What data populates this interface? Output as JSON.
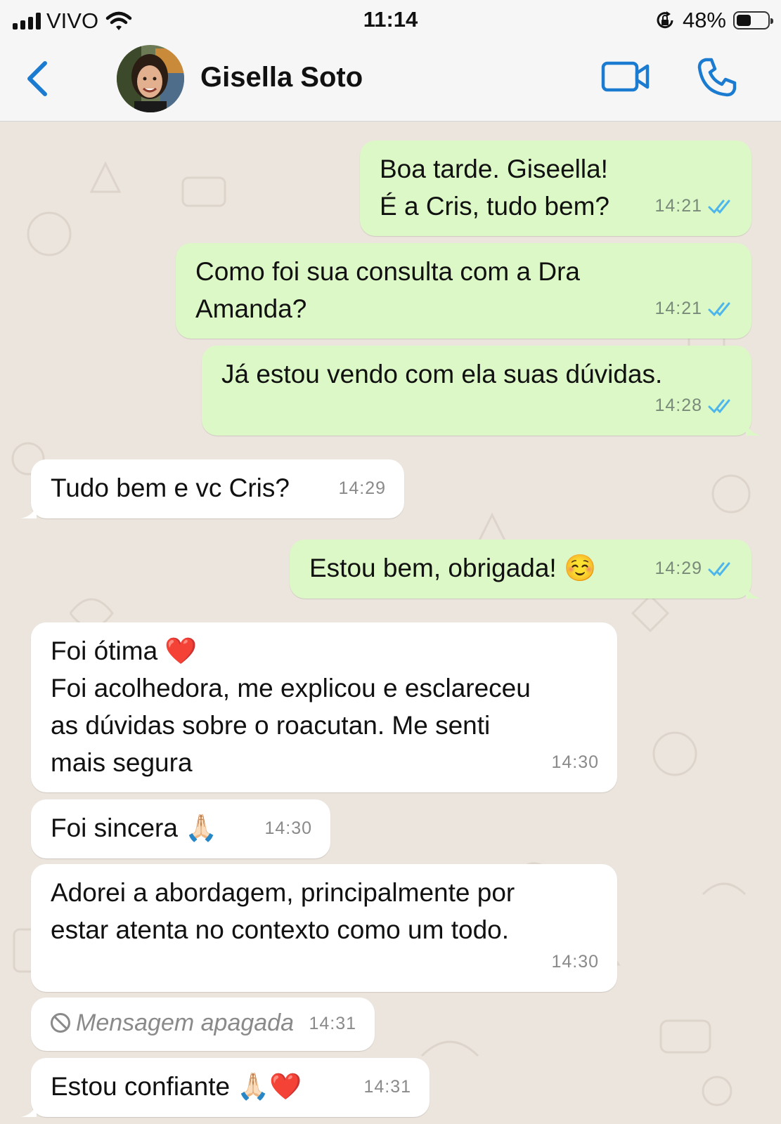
{
  "status_bar": {
    "carrier": "VIVO",
    "time": "11:14",
    "battery_percent": "48%",
    "battery_level": 0.48
  },
  "header": {
    "contact_name": "Gisella Soto",
    "back_icon": "chevron-left-icon",
    "video_icon": "video-camera-icon",
    "call_icon": "phone-icon"
  },
  "colors": {
    "outgoing_bubble": "#dcf8c6",
    "incoming_bubble": "#ffffff",
    "accent_blue": "#1a7bd1",
    "chat_background": "#ece5dd"
  },
  "messages": [
    {
      "direction": "out",
      "text": "Boa tarde. Giseella!\nÉ a Cris, tudo bem?",
      "time": "14:21",
      "read": true
    },
    {
      "direction": "out",
      "text": "Como foi sua consulta com a Dra\nAmanda?",
      "time": "14:21",
      "read": true
    },
    {
      "direction": "out",
      "text": "Já estou vendo com ela suas dúvidas.",
      "time": "14:28",
      "read": true
    },
    {
      "direction": "in",
      "text": "Tudo bem e vc Cris?",
      "time": "14:29"
    },
    {
      "direction": "out",
      "text": "Estou bem, obrigada! ☺️",
      "time": "14:29",
      "read": true
    },
    {
      "direction": "in",
      "text": "Foi ótima ❤️\nFoi acolhedora, me explicou e esclareceu\nas dúvidas sobre o roacutan. Me senti\nmais segura",
      "time": "14:30"
    },
    {
      "direction": "in",
      "text": "Foi sincera 🙏🏻",
      "time": "14:30"
    },
    {
      "direction": "in",
      "text": "Adorei a abordagem, principalmente por\nestar atenta no contexto como um todo.",
      "time": "14:30"
    },
    {
      "direction": "in",
      "text": "Mensagem apagada",
      "time": "14:31",
      "deleted": true
    },
    {
      "direction": "in",
      "text": "Estou confiante 🙏🏻❤️",
      "time": "14:31"
    }
  ]
}
